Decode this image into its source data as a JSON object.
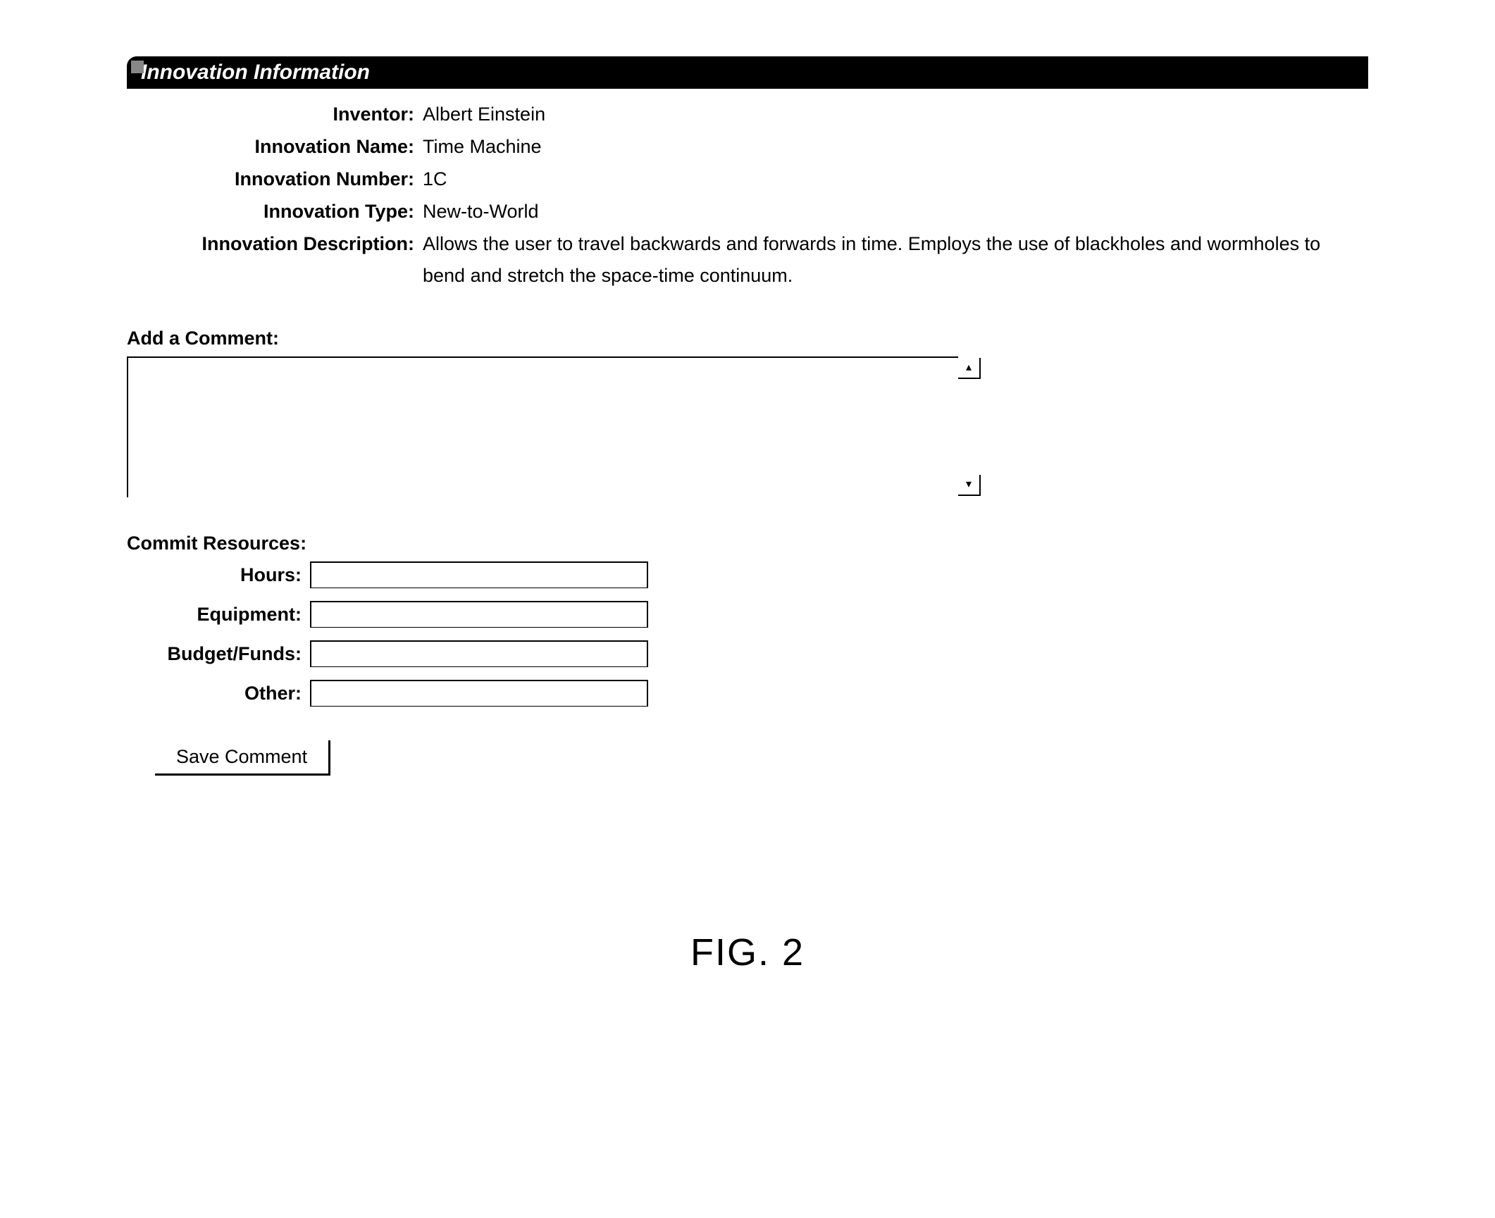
{
  "header": {
    "title": "Innovation Information"
  },
  "info": {
    "inventor_label": "Inventor:",
    "inventor_value": "Albert Einstein",
    "name_label": "Innovation Name:",
    "name_value": "Time Machine",
    "number_label": "Innovation Number:",
    "number_value": "1C",
    "type_label": "Innovation Type:",
    "type_value": "New-to-World",
    "description_label": "Innovation Description:",
    "description_value": "Allows the user to travel backwards and forwards in time.  Employs the use of blackholes and wormholes to bend and stretch the space-time continuum."
  },
  "comment": {
    "title": "Add a Comment:",
    "value": ""
  },
  "resources": {
    "title": "Commit Resources:",
    "hours_label": "Hours:",
    "hours_value": "",
    "equipment_label": "Equipment:",
    "equipment_value": "",
    "budget_label": "Budget/Funds:",
    "budget_value": "",
    "other_label": "Other:",
    "other_value": ""
  },
  "actions": {
    "save_label": "Save Comment"
  },
  "figure": {
    "label": "FIG. 2"
  }
}
